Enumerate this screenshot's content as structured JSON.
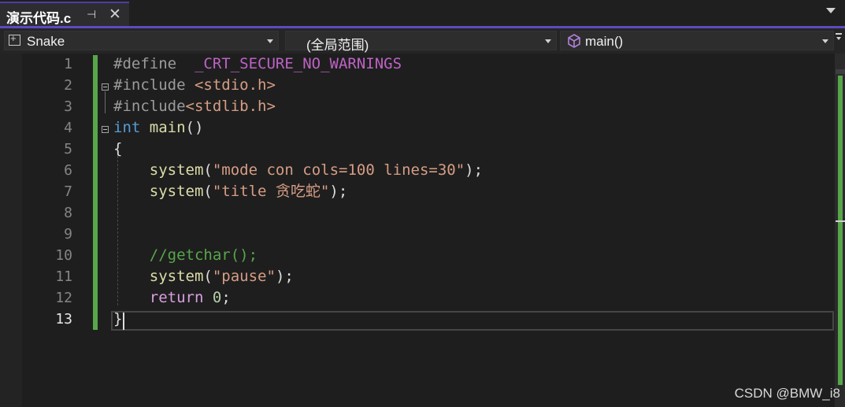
{
  "tab": {
    "title": "演示代码.c",
    "pin_glyph": "⊣",
    "close_glyph": "✕"
  },
  "navbar": {
    "project": "Snake",
    "scope": "(全局范围)",
    "member": "main()"
  },
  "editor": {
    "line_numbers": [
      "1",
      "2",
      "3",
      "4",
      "5",
      "6",
      "7",
      "8",
      "9",
      "10",
      "11",
      "12",
      "13"
    ],
    "current_line": 13,
    "lines": [
      [
        {
          "t": "#define",
          "c": "pp"
        },
        {
          "t": "  ",
          "c": "txt"
        },
        {
          "t": "_CRT_SECURE_NO_WARNINGS",
          "c": "macro"
        }
      ],
      [
        {
          "t": "#include",
          "c": "pp"
        },
        {
          "t": " ",
          "c": "txt"
        },
        {
          "t": "<stdio.h>",
          "c": "str"
        }
      ],
      [
        {
          "t": "#include",
          "c": "pp"
        },
        {
          "t": "<stdlib.h>",
          "c": "str"
        }
      ],
      [
        {
          "t": "int",
          "c": "kw"
        },
        {
          "t": " ",
          "c": "txt"
        },
        {
          "t": "main",
          "c": "fn"
        },
        {
          "t": "()",
          "c": "txt"
        }
      ],
      [
        {
          "t": "{",
          "c": "txt"
        }
      ],
      [
        {
          "t": "    ",
          "c": "txt"
        },
        {
          "t": "system",
          "c": "fn"
        },
        {
          "t": "(",
          "c": "txt"
        },
        {
          "t": "\"mode con cols=100 lines=30\"",
          "c": "str"
        },
        {
          "t": ");",
          "c": "txt"
        }
      ],
      [
        {
          "t": "    ",
          "c": "txt"
        },
        {
          "t": "system",
          "c": "fn"
        },
        {
          "t": "(",
          "c": "txt"
        },
        {
          "t": "\"title 贪吃蛇\"",
          "c": "str"
        },
        {
          "t": ");",
          "c": "txt"
        }
      ],
      [],
      [],
      [
        {
          "t": "    ",
          "c": "txt"
        },
        {
          "t": "//getchar();",
          "c": "cm"
        }
      ],
      [
        {
          "t": "    ",
          "c": "txt"
        },
        {
          "t": "system",
          "c": "fn"
        },
        {
          "t": "(",
          "c": "txt"
        },
        {
          "t": "\"pause\"",
          "c": "str"
        },
        {
          "t": ");",
          "c": "txt"
        }
      ],
      [
        {
          "t": "    ",
          "c": "txt"
        },
        {
          "t": "return",
          "c": "ret"
        },
        {
          "t": " ",
          "c": "txt"
        },
        {
          "t": "0",
          "c": "num"
        },
        {
          "t": ";",
          "c": "txt"
        }
      ],
      [
        {
          "t": "}",
          "c": "txt"
        }
      ]
    ]
  },
  "watermark": "CSDN @BMW_i8",
  "colors": {
    "tab_accent": "#5b4bc0",
    "change_bar": "#57a64a",
    "keyword": "#569cd6",
    "string": "#d69d85",
    "comment": "#57a64a"
  },
  "icons": {
    "project": "project-icon",
    "member": "cube-icon",
    "overflow": "chevron-down-icon"
  }
}
